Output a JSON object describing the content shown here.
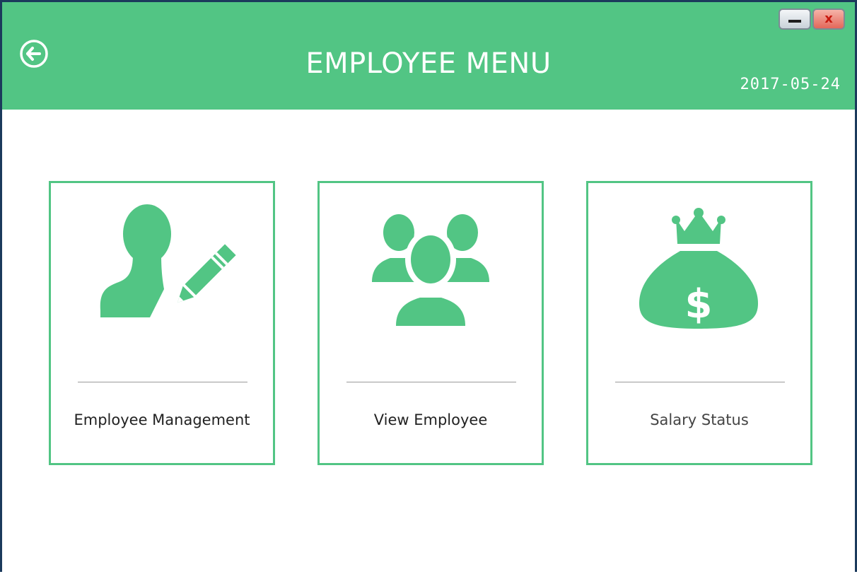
{
  "header": {
    "title": "EMPLOYEE MENU",
    "date": "2017-05-24",
    "close_glyph": "x",
    "back_icon": "back-arrow-circle-icon",
    "color": "#52c584"
  },
  "cards": [
    {
      "label": "Employee Management",
      "icon": "user-edit-icon"
    },
    {
      "label": "View Employee",
      "icon": "user-group-icon"
    },
    {
      "label": "Salary Status",
      "icon": "money-bag-icon"
    }
  ],
  "colors": {
    "accent": "#52c584",
    "window_border": "#1b3a5c",
    "divider": "#9a9a9a"
  }
}
